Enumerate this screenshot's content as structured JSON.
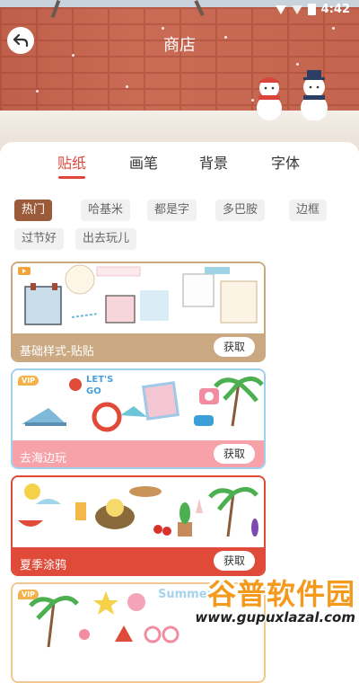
{
  "status_bar": {
    "time": "4:42"
  },
  "header": {
    "title": "商店"
  },
  "tabs": [
    {
      "label": "贴纸",
      "active": true
    },
    {
      "label": "画笔",
      "active": false
    },
    {
      "label": "背景",
      "active": false
    },
    {
      "label": "字体",
      "active": false
    }
  ],
  "filters": [
    {
      "label": "热门",
      "active": true
    },
    {
      "label": "哈基米",
      "active": false
    },
    {
      "label": "都是字",
      "active": false
    },
    {
      "label": "多巴胺",
      "active": false
    },
    {
      "label": "边框",
      "active": false
    },
    {
      "label": "过节好",
      "active": false
    },
    {
      "label": "出去玩儿",
      "active": false
    }
  ],
  "cards": [
    {
      "title": "基础样式-贴贴",
      "button": "获取",
      "vip": false,
      "bar_color": "#c9a882",
      "border_color": "#c9a882"
    },
    {
      "title": "去海边玩",
      "button": "获取",
      "vip": true,
      "vip_label": "VIP",
      "bar_color": "#f7a1a8",
      "border_color": "#9fd0f0"
    },
    {
      "title": "夏季涂鸦",
      "button": "获取",
      "vip": false,
      "bar_color": "#e04a38",
      "border_color": "#e04a38"
    },
    {
      "title": "",
      "button": "",
      "vip": true,
      "vip_label": "VIP",
      "bar_color": "#f0c890",
      "border_color": "#f0c890"
    }
  ],
  "stickers": {
    "card2_text": "LET'S GO",
    "card4_text": "Summer"
  },
  "watermark": {
    "logo": "谷普软件园",
    "url": "www.gupuxlazal.com"
  }
}
